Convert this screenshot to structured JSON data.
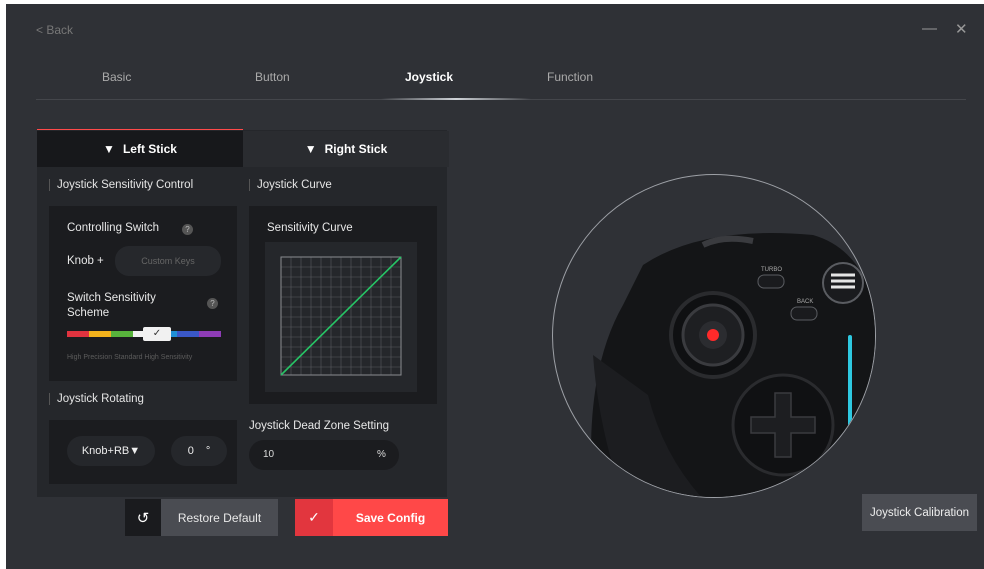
{
  "nav": {
    "back_label": "< Back",
    "minimize_label": "—",
    "close_label": "✕"
  },
  "tabs": [
    {
      "label": "Basic",
      "active": false
    },
    {
      "label": "Button",
      "active": false
    },
    {
      "label": "Joystick",
      "active": true
    },
    {
      "label": "Function",
      "active": false
    }
  ],
  "stick_tabs": {
    "left_label": "Left Stick",
    "right_label": "Right Stick",
    "selected": "left"
  },
  "sensitivity_control": {
    "title": "Joystick Sensitivity Control",
    "controlling_switch_label": "Controlling Switch",
    "knob_label": "Knob +",
    "custom_keys_placeholder": "Custom Keys",
    "scheme_label_line1": "Switch Sensitivity",
    "scheme_label_line2": "Scheme",
    "scheme_caption": "High Precision Standard High Sensitivity",
    "scheme_colors": [
      "#e0333f",
      "#f2b21c",
      "#58b33c",
      "#f2f2f2",
      "#1f8fd6",
      "#3a58c8",
      "#8e3cb6"
    ],
    "help_glyph": "?"
  },
  "curve": {
    "title": "Joystick Curve",
    "subtitle": "Sensitivity Curve",
    "line_color": "#27c466"
  },
  "rotating": {
    "title": "Joystick Rotating",
    "mode_label": "Knob+RB▼",
    "angle_value": "0",
    "angle_unit": "°"
  },
  "deadzone": {
    "title": "Joystick Dead Zone Setting",
    "value": "10",
    "unit": "%"
  },
  "buttons": {
    "restore_icon": "↺",
    "restore_label": "Restore Default",
    "save_icon": "✓",
    "save_label": "Save Config",
    "calibration_label": "Joystick Calibration"
  },
  "controller": {
    "turbo_label": "TURBO",
    "back_label": "BACK"
  },
  "colors": {
    "accent_red": "#ff4848",
    "curve_green": "#27c466",
    "light_strip": "#2ec8e0"
  }
}
